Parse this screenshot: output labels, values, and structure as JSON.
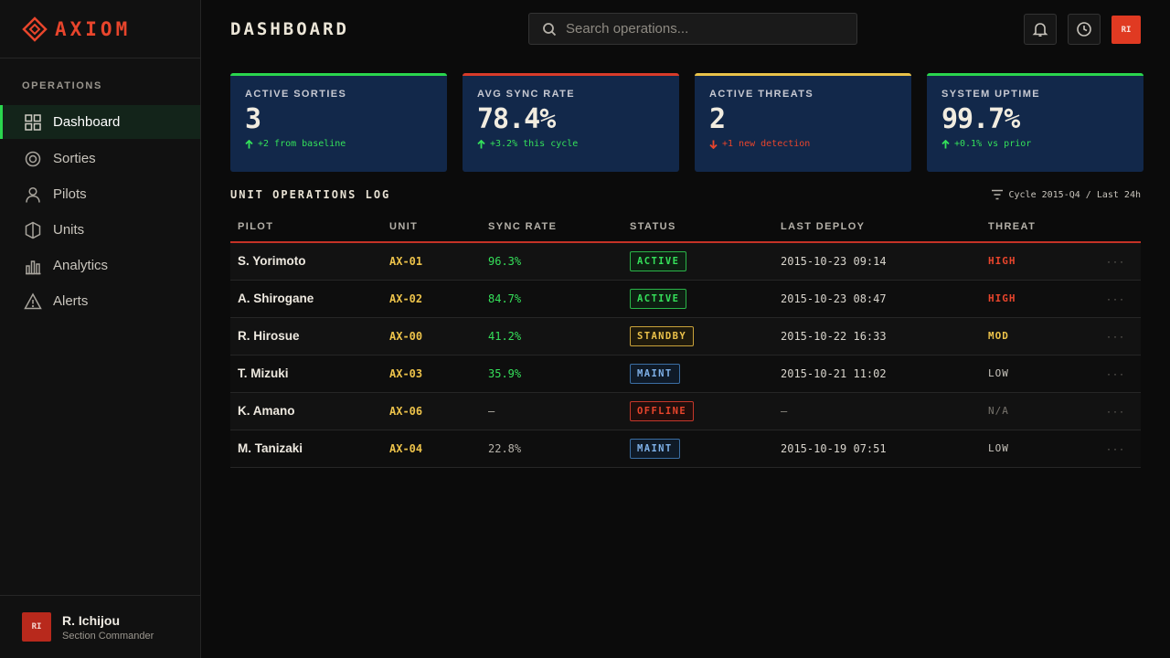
{
  "brand": {
    "name": "AXIOM",
    "accent": "#e8452c"
  },
  "sidebar": {
    "section_label": "OPERATIONS",
    "items": [
      {
        "label": "Dashboard",
        "icon": "grid-icon",
        "active": true
      },
      {
        "label": "Sorties",
        "icon": "target-icon"
      },
      {
        "label": "Pilots",
        "icon": "user-icon"
      },
      {
        "label": "Units",
        "icon": "shield-icon"
      },
      {
        "label": "Analytics",
        "icon": "bar-chart-icon"
      },
      {
        "label": "Alerts",
        "icon": "warning-icon"
      }
    ],
    "user": {
      "initials": "RI",
      "name": "R. Ichijou",
      "role": "Section Commander"
    }
  },
  "header": {
    "title": "DASHBOARD",
    "search": {
      "placeholder": "Search operations...",
      "value": ""
    },
    "avatar_initials": "RI"
  },
  "stats": [
    {
      "label": "ACTIVE SORTIES",
      "value": "3",
      "delta": "+2 from baseline",
      "direction": "up"
    },
    {
      "label": "AVG SYNC RATE",
      "value": "78.4%",
      "delta": "+3.2% this cycle",
      "direction": "up"
    },
    {
      "label": "ACTIVE THREATS",
      "value": "2",
      "delta": "+1 new detection",
      "direction": "down"
    },
    {
      "label": "SYSTEM UPTIME",
      "value": "99.7%",
      "delta": "+0.1% vs prior",
      "direction": "up"
    }
  ],
  "log": {
    "title": "UNIT OPERATIONS LOG",
    "filter": "Cycle 2015-Q4 / Last 24h",
    "columns": [
      "PILOT",
      "UNIT",
      "SYNC RATE",
      "STATUS",
      "LAST DEPLOY",
      "THREAT"
    ],
    "rows": [
      {
        "pilot": "S. Yorimoto",
        "unit": "AX-01",
        "sync": "96.3%",
        "status": "ACTIVE",
        "deploy": "2015-10-23 09:14",
        "threat": "HIGH"
      },
      {
        "pilot": "A. Shirogane",
        "unit": "AX-02",
        "sync": "84.7%",
        "status": "ACTIVE",
        "deploy": "2015-10-23 08:47",
        "threat": "HIGH"
      },
      {
        "pilot": "R. Hirosue",
        "unit": "AX-00",
        "sync": "41.2%",
        "status": "STANDBY",
        "deploy": "2015-10-22 16:33",
        "threat": "MOD"
      },
      {
        "pilot": "T. Mizuki",
        "unit": "AX-03",
        "sync": "35.9%",
        "status": "MAINT",
        "deploy": "2015-10-21 11:02",
        "threat": "LOW"
      },
      {
        "pilot": "K. Amano",
        "unit": "AX-06",
        "sync": "—",
        "status": "OFFLINE",
        "deploy": "—",
        "threat": "N/A"
      },
      {
        "pilot": "M. Tanizaki",
        "unit": "AX-04",
        "sync": "22.8%",
        "status": "MAINT",
        "deploy": "2015-10-19 07:51",
        "threat": "LOW"
      }
    ],
    "row_menu": "···"
  }
}
